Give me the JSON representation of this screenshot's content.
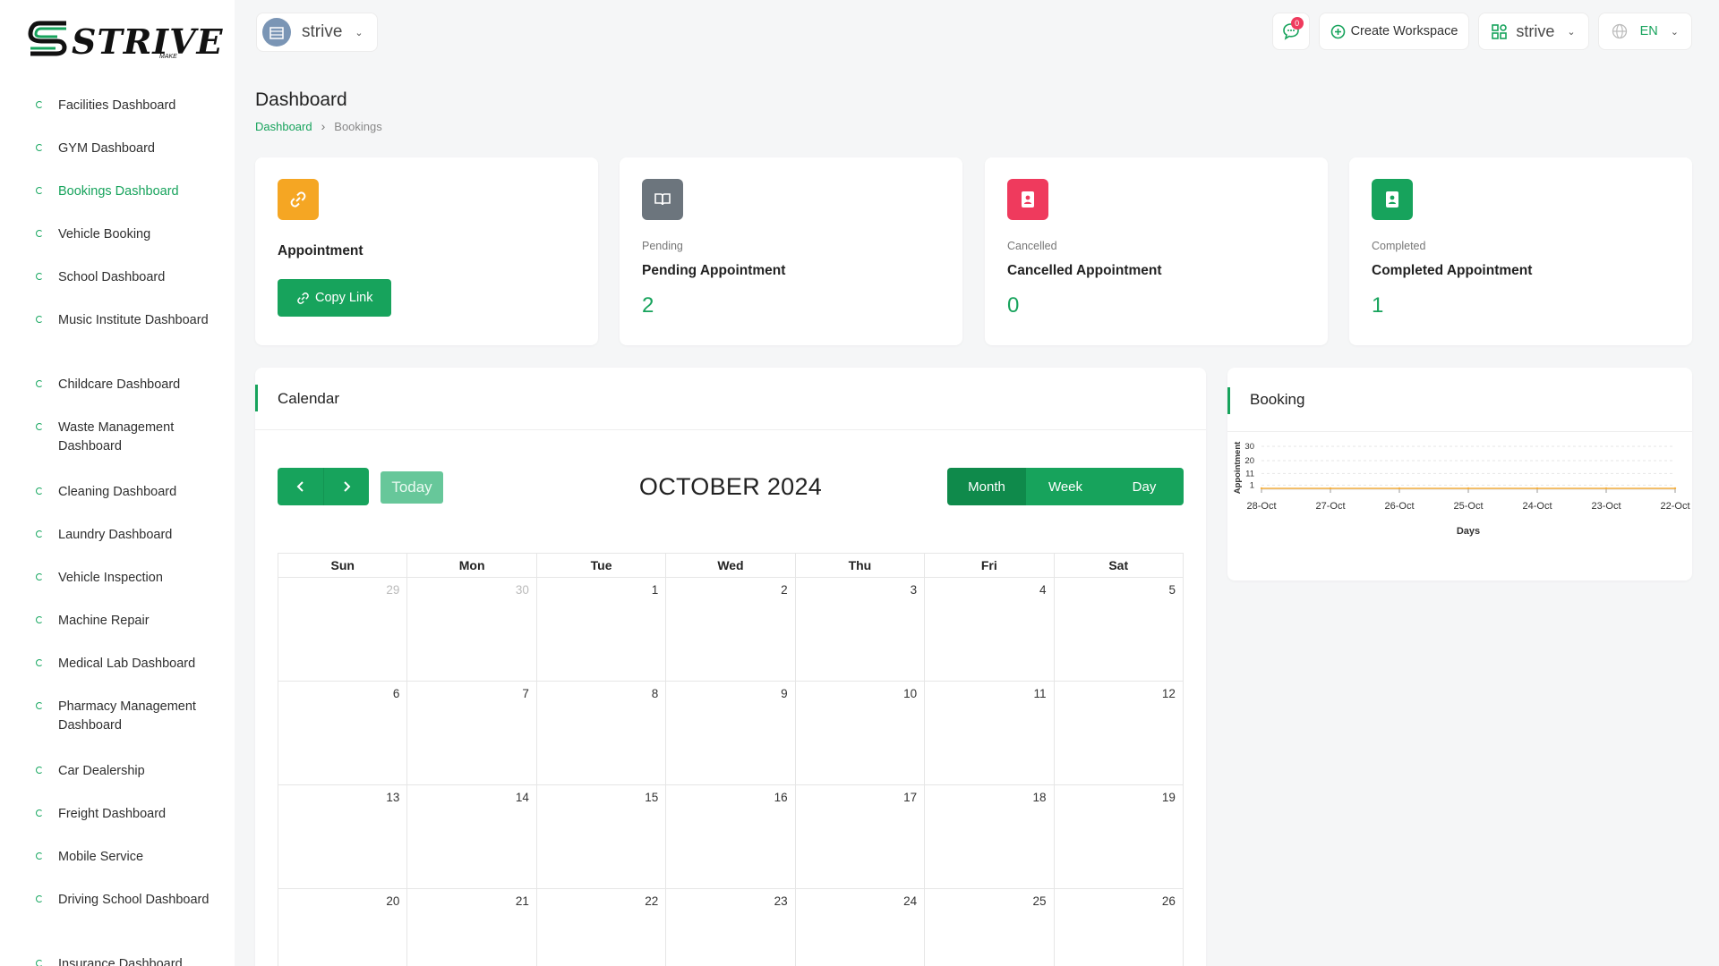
{
  "brand": {
    "name": "STRIVE",
    "sub": "MAKE"
  },
  "sidebar": {
    "items": [
      {
        "label": "Facilities Dashboard",
        "active": false
      },
      {
        "label": "GYM Dashboard",
        "active": false
      },
      {
        "label": "Bookings Dashboard",
        "active": true
      },
      {
        "label": "Vehicle Booking",
        "active": false
      },
      {
        "label": "School Dashboard",
        "active": false
      },
      {
        "label": "Music Institute Dashboard",
        "active": false
      },
      {
        "label": "Childcare Dashboard",
        "active": false
      },
      {
        "label": "Waste Management Dashboard",
        "active": false
      },
      {
        "label": "Cleaning Dashboard",
        "active": false
      },
      {
        "label": "Laundry Dashboard",
        "active": false
      },
      {
        "label": "Vehicle Inspection",
        "active": false
      },
      {
        "label": "Machine Repair",
        "active": false
      },
      {
        "label": "Medical Lab Dashboard",
        "active": false
      },
      {
        "label": "Pharmacy Management Dashboard",
        "active": false
      },
      {
        "label": "Car Dealership",
        "active": false
      },
      {
        "label": "Freight Dashboard",
        "active": false
      },
      {
        "label": "Mobile Service",
        "active": false
      },
      {
        "label": "Driving School Dashboard",
        "active": false
      },
      {
        "label": "Insurance Dashboard",
        "active": false
      }
    ]
  },
  "topbar": {
    "workspace_name": "strive",
    "notification_count": "0",
    "create_workspace_label": "Create Workspace",
    "workspace_menu_label": "strive",
    "language_label": "EN"
  },
  "page": {
    "title": "Dashboard",
    "breadcrumb": [
      "Dashboard",
      "Bookings"
    ]
  },
  "stats": {
    "appointment": {
      "title": "Appointment",
      "button_label": "Copy Link",
      "color": "#f5a623"
    },
    "pending": {
      "sub": "Pending",
      "title": "Pending Appointment",
      "value": "2",
      "color": "#6c757d"
    },
    "cancelled": {
      "sub": "Cancelled",
      "title": "Cancelled Appointment",
      "value": "0",
      "color": "#ef3a5d"
    },
    "completed": {
      "sub": "Completed",
      "title": "Completed Appointment",
      "value": "1",
      "color": "#17a35c"
    }
  },
  "calendar": {
    "panel_title": "Calendar",
    "month_title": "OCTOBER 2024",
    "today_label": "Today",
    "views": [
      "Month",
      "Week",
      "Day"
    ],
    "active_view": "Month",
    "weekdays": [
      "Sun",
      "Mon",
      "Tue",
      "Wed",
      "Thu",
      "Fri",
      "Sat"
    ],
    "weeks": [
      [
        {
          "d": "29",
          "o": true
        },
        {
          "d": "30",
          "o": true
        },
        {
          "d": "1"
        },
        {
          "d": "2"
        },
        {
          "d": "3"
        },
        {
          "d": "4"
        },
        {
          "d": "5"
        }
      ],
      [
        {
          "d": "6"
        },
        {
          "d": "7"
        },
        {
          "d": "8"
        },
        {
          "d": "9"
        },
        {
          "d": "10"
        },
        {
          "d": "11"
        },
        {
          "d": "12"
        }
      ],
      [
        {
          "d": "13"
        },
        {
          "d": "14"
        },
        {
          "d": "15"
        },
        {
          "d": "16"
        },
        {
          "d": "17"
        },
        {
          "d": "18"
        },
        {
          "d": "19"
        }
      ],
      [
        {
          "d": "20"
        },
        {
          "d": "21"
        },
        {
          "d": "22"
        },
        {
          "d": "23"
        },
        {
          "d": "24"
        },
        {
          "d": "25"
        },
        {
          "d": "26"
        }
      ]
    ]
  },
  "booking": {
    "panel_title": "Booking"
  },
  "chart_data": {
    "type": "line",
    "categories": [
      "28-Oct",
      "27-Oct",
      "26-Oct",
      "25-Oct",
      "24-Oct",
      "23-Oct",
      "22-Oct"
    ],
    "series": [
      {
        "values": [
          0,
          0,
          0,
          0,
          0,
          0,
          0
        ],
        "color": "#f5b041"
      }
    ],
    "xlabel": "Days",
    "ylabel": "Appointment",
    "yticks": [
      1,
      11,
      20,
      30
    ],
    "grid": true
  }
}
